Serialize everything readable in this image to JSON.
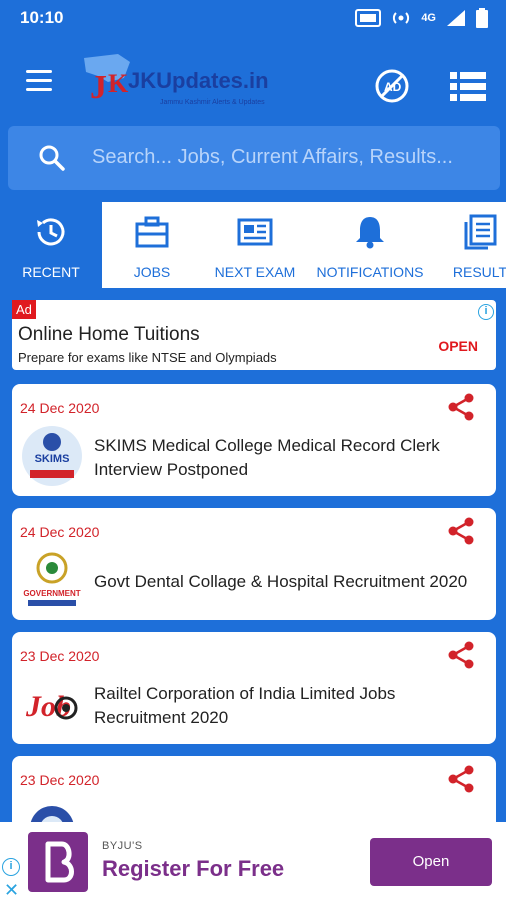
{
  "status_bar": {
    "time": "10:10",
    "network": "4G"
  },
  "app_bar": {
    "logo_text": "JKUpdates.in",
    "logo_tagline": "Jammu Kashmir Alerts & Updates"
  },
  "search": {
    "placeholder": "Search... Jobs, Current Affairs, Results..."
  },
  "tabs": [
    {
      "label": "RECENT",
      "icon": "history-icon",
      "active": true
    },
    {
      "label": "JOBS",
      "icon": "briefcase-icon",
      "active": false
    },
    {
      "label": "NEXT EXAM",
      "icon": "newspaper-icon",
      "active": false
    },
    {
      "label": "NOTIFICATIONS",
      "icon": "bell-icon",
      "active": false
    },
    {
      "label": "RESULT",
      "icon": "documents-icon",
      "active": false
    }
  ],
  "top_ad": {
    "badge": "Ad",
    "title": "Online Home Tuitions",
    "subtitle": "Prepare for exams like NTSE and Olympiads",
    "cta": "OPEN"
  },
  "posts": [
    {
      "date": "24 Dec 2020",
      "title": "SKIMS Medical College Medical Record Clerk Interview Postponed",
      "thumb_text": "SKIMS"
    },
    {
      "date": "24 Dec 2020",
      "title": "Govt Dental Collage & Hospital Recruitment 2020",
      "thumb_text": "GOVERNMENT"
    },
    {
      "date": "23 Dec 2020",
      "title": "Railtel Corporation of India Limited Jobs Recruitment 2020",
      "thumb_text": "Job"
    },
    {
      "date": "23 Dec 2020",
      "title": "",
      "thumb_text": ""
    }
  ],
  "bottom_ad": {
    "brand": "BYJU'S",
    "title": "Register For Free",
    "cta": "Open",
    "close": "✕",
    "info": "i"
  },
  "colors": {
    "primary": "#1e6fd9",
    "accent_red": "#d2232a",
    "ad_purple": "#7b2f8a"
  }
}
